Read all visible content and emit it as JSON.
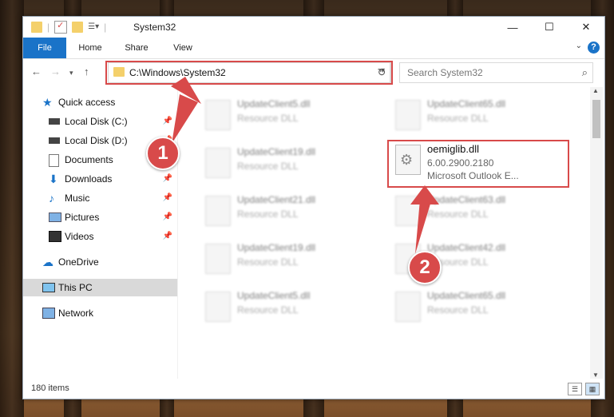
{
  "window": {
    "title": "System32",
    "controls": {
      "minimize": "—",
      "maximize": "☐",
      "close": "✕"
    }
  },
  "ribbon": {
    "tabs": [
      "File",
      "Home",
      "Share",
      "View"
    ],
    "help": "?"
  },
  "nav": {
    "address": "C:\\Windows\\System32",
    "search_placeholder": "Search System32"
  },
  "sidebar": {
    "items": [
      {
        "label": "Quick access",
        "icon": "star-icon"
      },
      {
        "label": "Local Disk (C:)",
        "icon": "drive-icon"
      },
      {
        "label": "Local Disk (D:)",
        "icon": "drive-icon"
      },
      {
        "label": "Documents",
        "icon": "documents-icon"
      },
      {
        "label": "Downloads",
        "icon": "download-icon"
      },
      {
        "label": "Music",
        "icon": "music-icon"
      },
      {
        "label": "Pictures",
        "icon": "pictures-icon"
      },
      {
        "label": "Videos",
        "icon": "videos-icon"
      },
      {
        "label": "OneDrive",
        "icon": "cloud-icon"
      },
      {
        "label": "This PC",
        "icon": "computer-icon"
      },
      {
        "label": "Network",
        "icon": "network-icon"
      }
    ]
  },
  "files": {
    "left": [
      {
        "name": "UpdateClient5.dll",
        "desc": "Resource DLL"
      },
      {
        "name": "UpdateClient19.dll",
        "desc": "Resource DLL"
      },
      {
        "name": "UpdateClient21.dll",
        "desc": "Resource DLL"
      },
      {
        "name": "UpdateClient19.dll",
        "desc": "Resource DLL"
      },
      {
        "name": "UpdateClient5.dll",
        "desc": "Resource DLL"
      }
    ],
    "right": [
      {
        "name": "UpdateClient65.dll",
        "desc": "Resource DLL"
      },
      {
        "name": "UpdateClient63.dll",
        "desc": "Resource DLL"
      },
      {
        "name": "UpdateClient42.dll",
        "desc": "Resource DLL"
      },
      {
        "name": "UpdateClient65.dll",
        "desc": "Resource DLL"
      }
    ],
    "highlighted": {
      "name": "oemiglib.dll",
      "version": "6.00.2900.2180",
      "desc": "Microsoft Outlook E..."
    }
  },
  "annotations": {
    "badge1": "1",
    "badge2": "2",
    "color": "#d84a4a"
  },
  "status": {
    "items": "180 items"
  }
}
